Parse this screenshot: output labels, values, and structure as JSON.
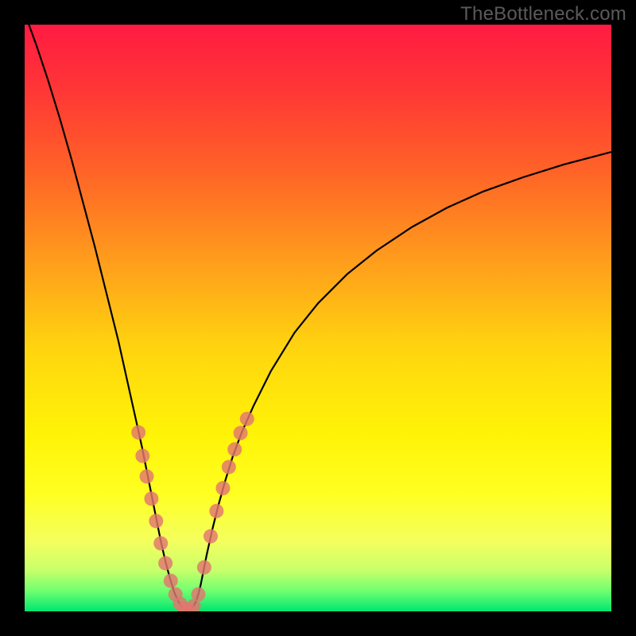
{
  "watermark": "TheBottleneck.com",
  "chart_data": {
    "type": "line",
    "title": "",
    "xlabel": "",
    "ylabel": "",
    "xlim": [
      0,
      100
    ],
    "ylim": [
      0,
      100
    ],
    "grid": false,
    "legend": false,
    "background": {
      "type": "vertical-gradient",
      "stops": [
        {
          "pos": 0.0,
          "color": "#ff1b42"
        },
        {
          "pos": 0.1,
          "color": "#ff3337"
        },
        {
          "pos": 0.25,
          "color": "#ff6327"
        },
        {
          "pos": 0.4,
          "color": "#ff9c1c"
        },
        {
          "pos": 0.55,
          "color": "#ffd40f"
        },
        {
          "pos": 0.7,
          "color": "#fff407"
        },
        {
          "pos": 0.8,
          "color": "#ffff22"
        },
        {
          "pos": 0.88,
          "color": "#f4ff5e"
        },
        {
          "pos": 0.93,
          "color": "#c8ff6a"
        },
        {
          "pos": 0.965,
          "color": "#70ff70"
        },
        {
          "pos": 1.0,
          "color": "#00e670"
        }
      ]
    },
    "series": [
      {
        "name": "bottleneck-curve",
        "stroke": "#000000",
        "stroke_width": 2.2,
        "x": [
          0,
          2,
          4,
          6,
          8,
          10,
          12,
          14,
          16,
          17,
          18,
          19,
          20,
          20.8,
          21.6,
          22.4,
          23.2,
          24,
          24.8,
          25.6,
          26.4,
          27,
          27.6,
          28,
          28.4,
          28.8,
          29.2,
          29.6,
          30,
          30.4,
          31,
          32,
          33,
          34.2,
          35.5,
          37,
          39,
          42,
          46,
          50,
          55,
          60,
          66,
          72,
          78,
          85,
          92,
          100
        ],
        "y": [
          102,
          96.5,
          90.5,
          84,
          77,
          69.5,
          62,
          54,
          46,
          41.5,
          37,
          32.5,
          28,
          24,
          20,
          16,
          12,
          8.5,
          5.5,
          3,
          1.3,
          0.5,
          0.2,
          0.2,
          0.4,
          0.9,
          1.7,
          2.9,
          4.5,
          6.5,
          9.5,
          14,
          18,
          22.3,
          26.5,
          30.5,
          35,
          41,
          47.5,
          52.5,
          57.5,
          61.5,
          65.5,
          68.8,
          71.5,
          74,
          76.2,
          78.3
        ]
      }
    ],
    "markers": {
      "name": "highlight-dots",
      "fill": "#e2766f",
      "fill_opacity": 0.82,
      "radius": 9,
      "x": [
        19.4,
        20.1,
        20.8,
        21.6,
        22.4,
        23.2,
        24.0,
        24.9,
        25.7,
        26.5,
        27.2,
        28.0,
        28.8,
        29.6,
        30.6,
        31.7,
        32.7,
        33.8,
        34.8,
        35.8,
        36.8,
        37.9
      ],
      "y": [
        30.5,
        26.5,
        23.0,
        19.2,
        15.4,
        11.6,
        8.2,
        5.2,
        2.9,
        1.3,
        0.5,
        0.2,
        0.9,
        2.9,
        7.5,
        12.8,
        17.1,
        21.0,
        24.6,
        27.6,
        30.4,
        32.8
      ]
    }
  }
}
